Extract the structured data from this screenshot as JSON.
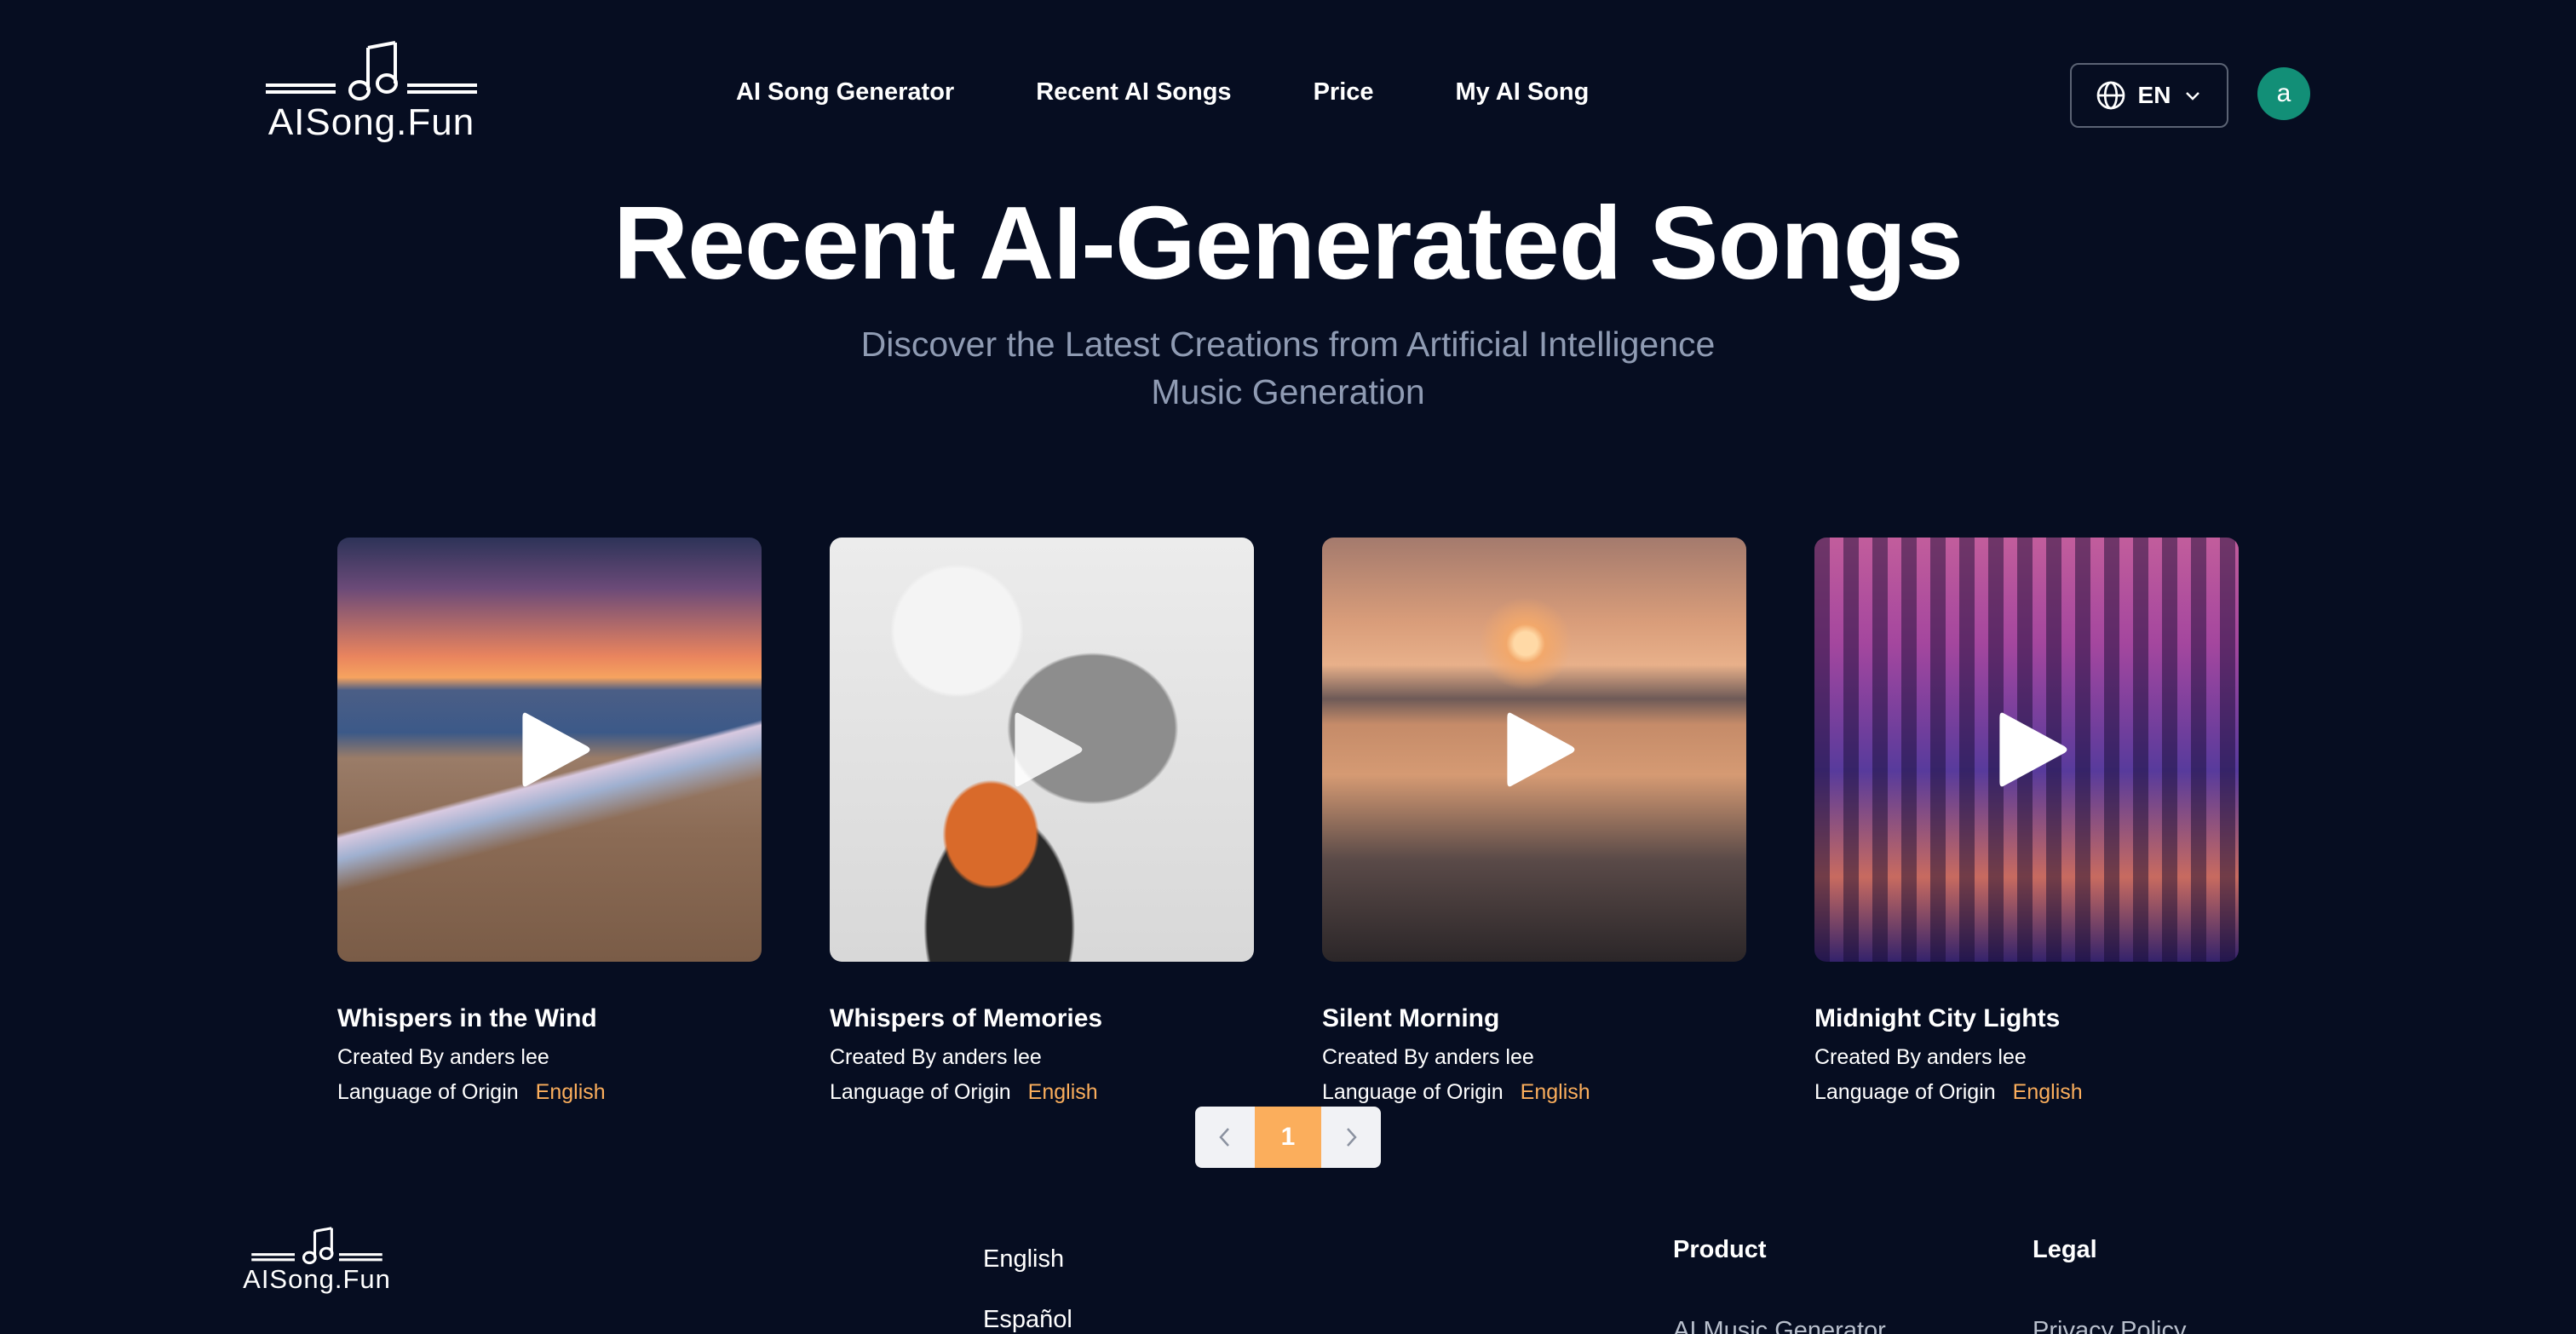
{
  "brand": {
    "name": "AISong.Fun"
  },
  "nav": {
    "items": [
      "AI Song Generator",
      "Recent AI Songs",
      "Price",
      "My AI Song"
    ]
  },
  "language_selector": {
    "label": "EN",
    "icon": "globe-icon"
  },
  "user": {
    "avatar_letter": "a",
    "avatar_color": "#128f77"
  },
  "hero": {
    "title": "Recent AI-Generated Songs",
    "subtitle": "Discover the Latest Creations from Artificial Intelligence Music Generation"
  },
  "songs": [
    {
      "title": "Whispers in the Wind",
      "creator": "Created By anders lee",
      "language_label": "Language of Origin",
      "language": "English"
    },
    {
      "title": "Whispers of Memories",
      "creator": "Created By anders lee",
      "language_label": "Language of Origin",
      "language": "English"
    },
    {
      "title": "Silent Morning",
      "creator": "Created By anders lee",
      "language_label": "Language of Origin",
      "language": "English"
    },
    {
      "title": "Midnight City Lights",
      "creator": "Created By anders lee",
      "language_label": "Language of Origin",
      "language": "English"
    }
  ],
  "pagination": {
    "current_page": "1"
  },
  "footer": {
    "languages": [
      "English",
      "Español"
    ],
    "product_heading": "Product",
    "product_link": "AI Music Generator",
    "legal_heading": "Legal",
    "legal_link": "Privacy Policy"
  },
  "colors": {
    "background": "#060d21",
    "accent": "#fbae5c",
    "muted_text": "#8f9bb3"
  }
}
